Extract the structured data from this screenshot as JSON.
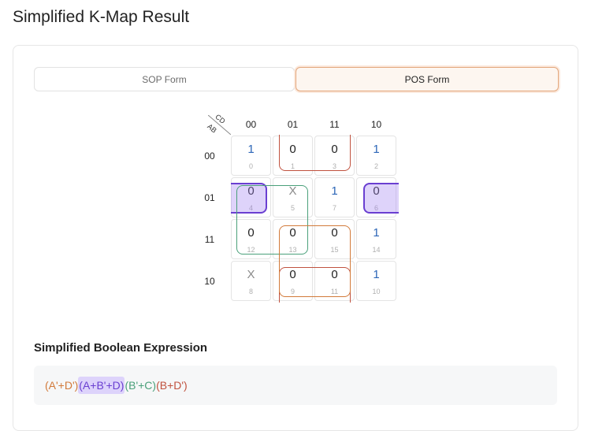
{
  "page_title": "Simplified K-Map Result",
  "tabs": {
    "sop": "SOP Form",
    "pos": "POS Form"
  },
  "kmap": {
    "corner_top": "CD",
    "corner_bottom": "AB",
    "col_headers": [
      "00",
      "01",
      "11",
      "10"
    ],
    "row_headers": [
      "00",
      "01",
      "11",
      "10"
    ],
    "cells": [
      [
        {
          "v": "1",
          "i": "0"
        },
        {
          "v": "0",
          "i": "1"
        },
        {
          "v": "0",
          "i": "3"
        },
        {
          "v": "1",
          "i": "2"
        }
      ],
      [
        {
          "v": "0",
          "i": "4"
        },
        {
          "v": "X",
          "i": "5"
        },
        {
          "v": "1",
          "i": "7"
        },
        {
          "v": "0",
          "i": "6"
        }
      ],
      [
        {
          "v": "0",
          "i": "12"
        },
        {
          "v": "0",
          "i": "13"
        },
        {
          "v": "0",
          "i": "15"
        },
        {
          "v": "1",
          "i": "14"
        }
      ],
      [
        {
          "v": "X",
          "i": "8"
        },
        {
          "v": "0",
          "i": "9"
        },
        {
          "v": "0",
          "i": "11"
        },
        {
          "v": "1",
          "i": "10"
        }
      ]
    ]
  },
  "expression": {
    "title": "Simplified Boolean Expression",
    "terms": [
      {
        "text": "(A'+D')",
        "color": "#d27a3a",
        "highlight": false
      },
      {
        "text": "(A+B'+D)",
        "color": "#6a3fd1",
        "highlight": true
      },
      {
        "text": "(B'+C)",
        "color": "#4aa07a",
        "highlight": false
      },
      {
        "text": "(B+D')",
        "color": "#c0523f",
        "highlight": false
      }
    ]
  },
  "colors": {
    "one": "#2e67b8",
    "zero": "#1f1f1f",
    "dontcare": "#8a8a8a",
    "accent": "#e3a67b"
  }
}
